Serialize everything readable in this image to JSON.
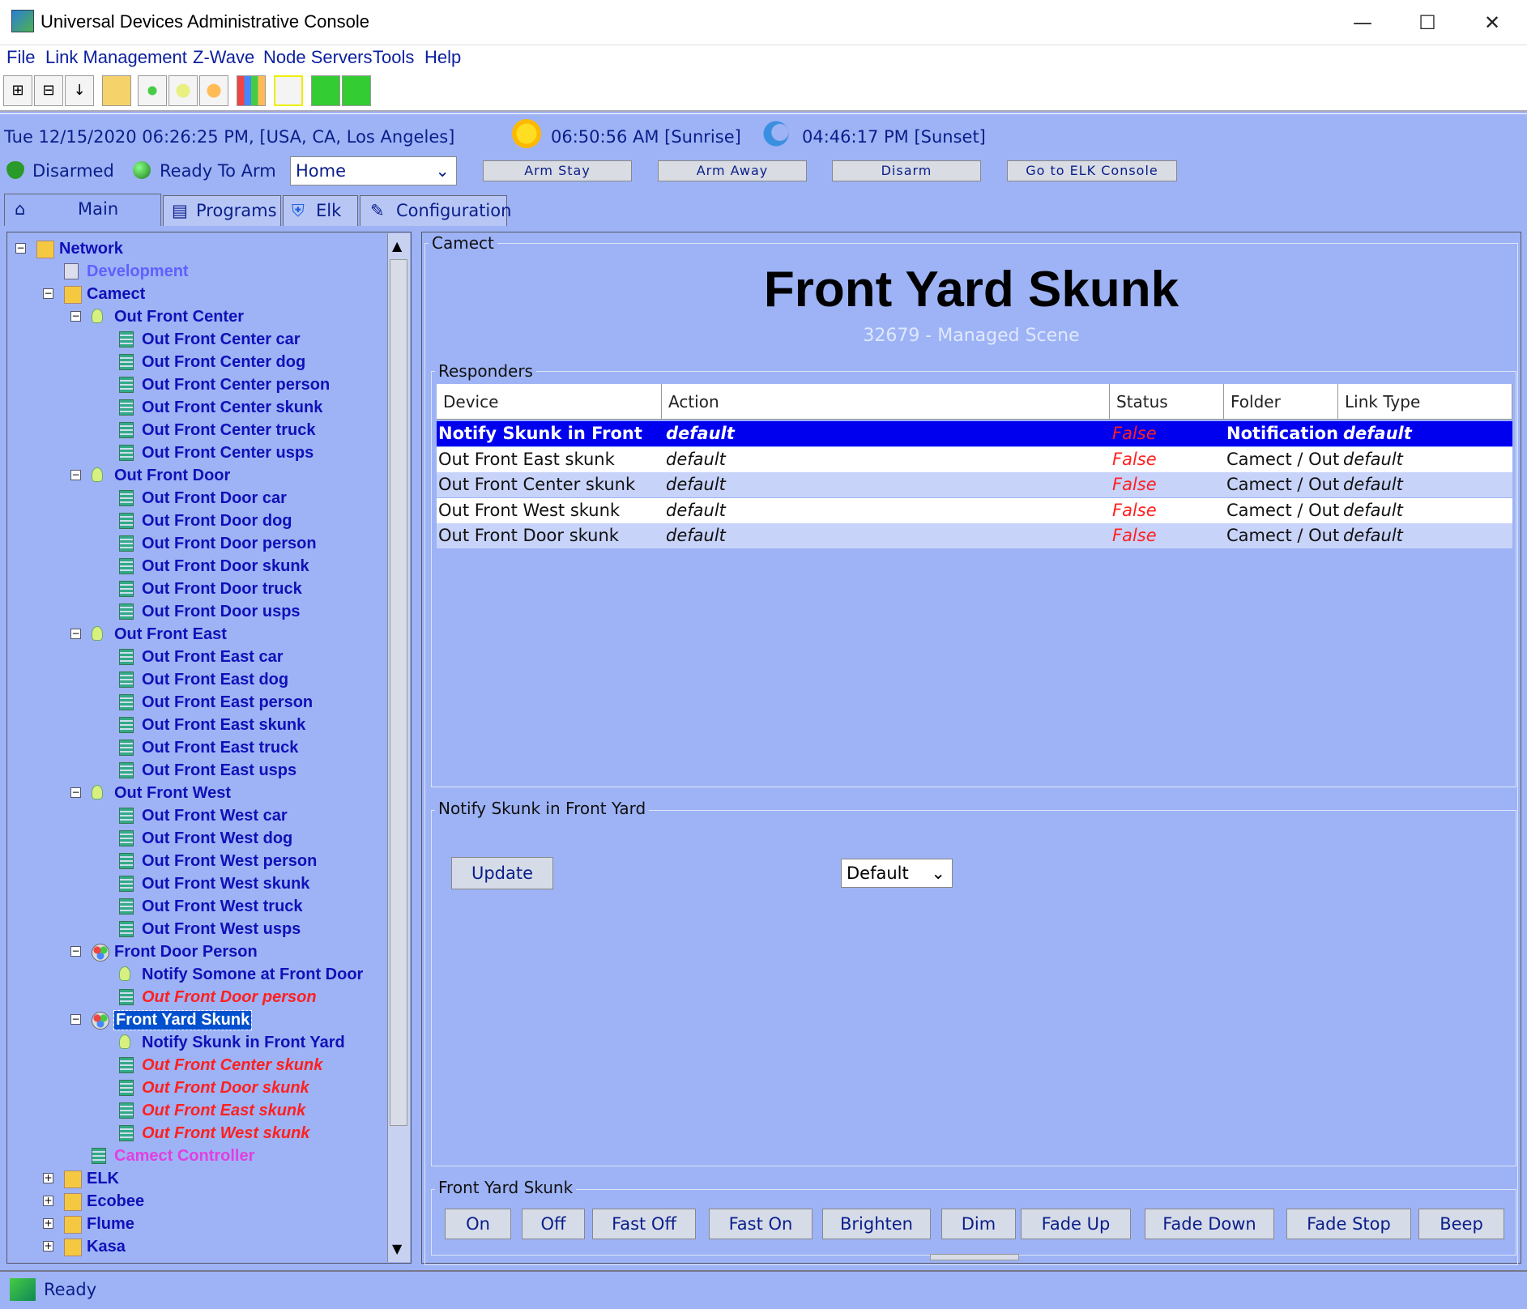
{
  "window": {
    "title": "Universal Devices Administrative Console",
    "minimize": "—",
    "maximize": "☐",
    "close": "✕"
  },
  "menu": [
    "File",
    "Link Management",
    "Z-Wave",
    "Node Servers",
    "Tools",
    "Help"
  ],
  "toolbar": {
    "expand": "⊞",
    "collapse": "⊟",
    "sort": "↓",
    "icons": [
      "expand-all-icon",
      "collapse-all-icon",
      "sort-icon",
      "folder-icon",
      "scene-icon",
      "bulb-icon",
      "refresh-icon",
      "chart-icon",
      "blank-icon",
      "binary-icon",
      "battery-icon"
    ]
  },
  "info": {
    "datetime": "Tue 12/15/2020 06:26:25 PM,  [USA, CA, Los Angeles]",
    "sunrise": "06:50:56 AM [Sunrise]",
    "sunset": "04:46:17 PM [Sunset]",
    "disarmed": "Disarmed",
    "ready": "Ready To Arm",
    "mode": "Home",
    "arm_stay": "Arm Stay",
    "arm_away": "Arm Away",
    "disarm": "Disarm",
    "elk_console": "Go to ELK Console"
  },
  "tabs": [
    "Main",
    "Programs",
    "Elk",
    "Configuration"
  ],
  "tree": [
    {
      "label": "Network",
      "type": "folder",
      "level": 0,
      "exp": "−"
    },
    {
      "label": "Development",
      "type": "doc",
      "level": 1,
      "style": "purple"
    },
    {
      "label": "Camect",
      "type": "folder",
      "level": 1,
      "exp": "−"
    },
    {
      "label": "Out Front Center",
      "type": "bulb",
      "level": 2,
      "exp": "−"
    },
    {
      "label": "Out Front Center car",
      "type": "dev",
      "level": 3
    },
    {
      "label": "Out Front Center dog",
      "type": "dev",
      "level": 3
    },
    {
      "label": "Out Front Center person",
      "type": "dev",
      "level": 3
    },
    {
      "label": "Out Front Center skunk",
      "type": "dev",
      "level": 3
    },
    {
      "label": "Out Front Center truck",
      "type": "dev",
      "level": 3
    },
    {
      "label": "Out Front Center usps",
      "type": "dev",
      "level": 3
    },
    {
      "label": "Out Front Door",
      "type": "bulb",
      "level": 2,
      "exp": "−"
    },
    {
      "label": "Out Front Door car",
      "type": "dev",
      "level": 3
    },
    {
      "label": "Out Front Door dog",
      "type": "dev",
      "level": 3
    },
    {
      "label": "Out Front Door person",
      "type": "dev",
      "level": 3
    },
    {
      "label": "Out Front Door skunk",
      "type": "dev",
      "level": 3
    },
    {
      "label": "Out Front Door truck",
      "type": "dev",
      "level": 3
    },
    {
      "label": "Out Front Door usps",
      "type": "dev",
      "level": 3
    },
    {
      "label": "Out Front East",
      "type": "bulb",
      "level": 2,
      "exp": "−"
    },
    {
      "label": "Out Front East car",
      "type": "dev",
      "level": 3
    },
    {
      "label": "Out Front East dog",
      "type": "dev",
      "level": 3
    },
    {
      "label": "Out Front East person",
      "type": "dev",
      "level": 3
    },
    {
      "label": "Out Front East skunk",
      "type": "dev",
      "level": 3
    },
    {
      "label": "Out Front East truck",
      "type": "dev",
      "level": 3
    },
    {
      "label": "Out Front East usps",
      "type": "dev",
      "level": 3
    },
    {
      "label": "Out Front West",
      "type": "bulb",
      "level": 2,
      "exp": "−"
    },
    {
      "label": "Out Front West car",
      "type": "dev",
      "level": 3
    },
    {
      "label": "Out Front West dog",
      "type": "dev",
      "level": 3
    },
    {
      "label": "Out Front West person",
      "type": "dev",
      "level": 3
    },
    {
      "label": "Out Front West skunk",
      "type": "dev",
      "level": 3
    },
    {
      "label": "Out Front West truck",
      "type": "dev",
      "level": 3
    },
    {
      "label": "Out Front West usps",
      "type": "dev",
      "level": 3
    },
    {
      "label": "Front Door Person",
      "type": "scene",
      "level": 2,
      "exp": "−"
    },
    {
      "label": "Notify Somone at Front Door",
      "type": "bulb",
      "level": 3
    },
    {
      "label": "Out Front Door person",
      "type": "dev",
      "level": 3,
      "style": "red"
    },
    {
      "label": "Front Yard Skunk",
      "type": "scene",
      "level": 2,
      "exp": "−",
      "style": "sel-node"
    },
    {
      "label": "Notify Skunk in Front Yard",
      "type": "bulb",
      "level": 3
    },
    {
      "label": "Out Front Center skunk",
      "type": "dev",
      "level": 3,
      "style": "red"
    },
    {
      "label": "Out Front Door skunk",
      "type": "dev",
      "level": 3,
      "style": "red"
    },
    {
      "label": "Out Front East skunk",
      "type": "dev",
      "level": 3,
      "style": "red"
    },
    {
      "label": "Out Front West skunk",
      "type": "dev",
      "level": 3,
      "style": "red"
    },
    {
      "label": "Camect Controller",
      "type": "dev",
      "level": 2,
      "style": "mag"
    },
    {
      "label": "ELK",
      "type": "folder",
      "level": 1,
      "exp": "+"
    },
    {
      "label": "Ecobee",
      "type": "folder",
      "level": 1,
      "exp": "+"
    },
    {
      "label": "Flume",
      "type": "folder",
      "level": 1,
      "exp": "+"
    },
    {
      "label": "Kasa",
      "type": "folder",
      "level": 1,
      "exp": "+"
    }
  ],
  "detail": {
    "group_label": "Camect",
    "scene_title": "Front Yard Skunk",
    "scene_sub": "32679 - Managed Scene",
    "responders_label": "Responders",
    "columns": [
      "Device",
      "Action",
      "Status",
      "Folder",
      "Link Type"
    ],
    "rows": [
      {
        "device": "Notify Skunk in Front",
        "action": "default",
        "status": "False",
        "folder": "Notification",
        "link": "default",
        "selected": true
      },
      {
        "device": "Out Front East skunk",
        "action": "default",
        "status": "False",
        "folder": "Camect / Out",
        "link": "default"
      },
      {
        "device": "Out Front Center skunk",
        "action": "default",
        "status": "False",
        "folder": "Camect / Out",
        "link": "default"
      },
      {
        "device": "Out Front West skunk",
        "action": "default",
        "status": "False",
        "folder": "Camect / Out",
        "link": "default"
      },
      {
        "device": "Out Front Door skunk",
        "action": "default",
        "status": "False",
        "folder": "Camect / Out",
        "link": "default"
      }
    ],
    "notify_label": "Notify Skunk in Front Yard",
    "update_btn": "Update",
    "default_select": "Default",
    "controls_label": "Front Yard Skunk",
    "controls": [
      "On",
      "Off",
      "Fast Off",
      "Fast On",
      "Brighten",
      "Dim",
      "Fade Up",
      "Fade Down",
      "Fade Stop",
      "Beep"
    ]
  },
  "status": "Ready",
  "colors": {
    "accent": "#0000ee",
    "panel": "#9eb3f5",
    "link": "#1010b8",
    "error": "#ff2020"
  }
}
